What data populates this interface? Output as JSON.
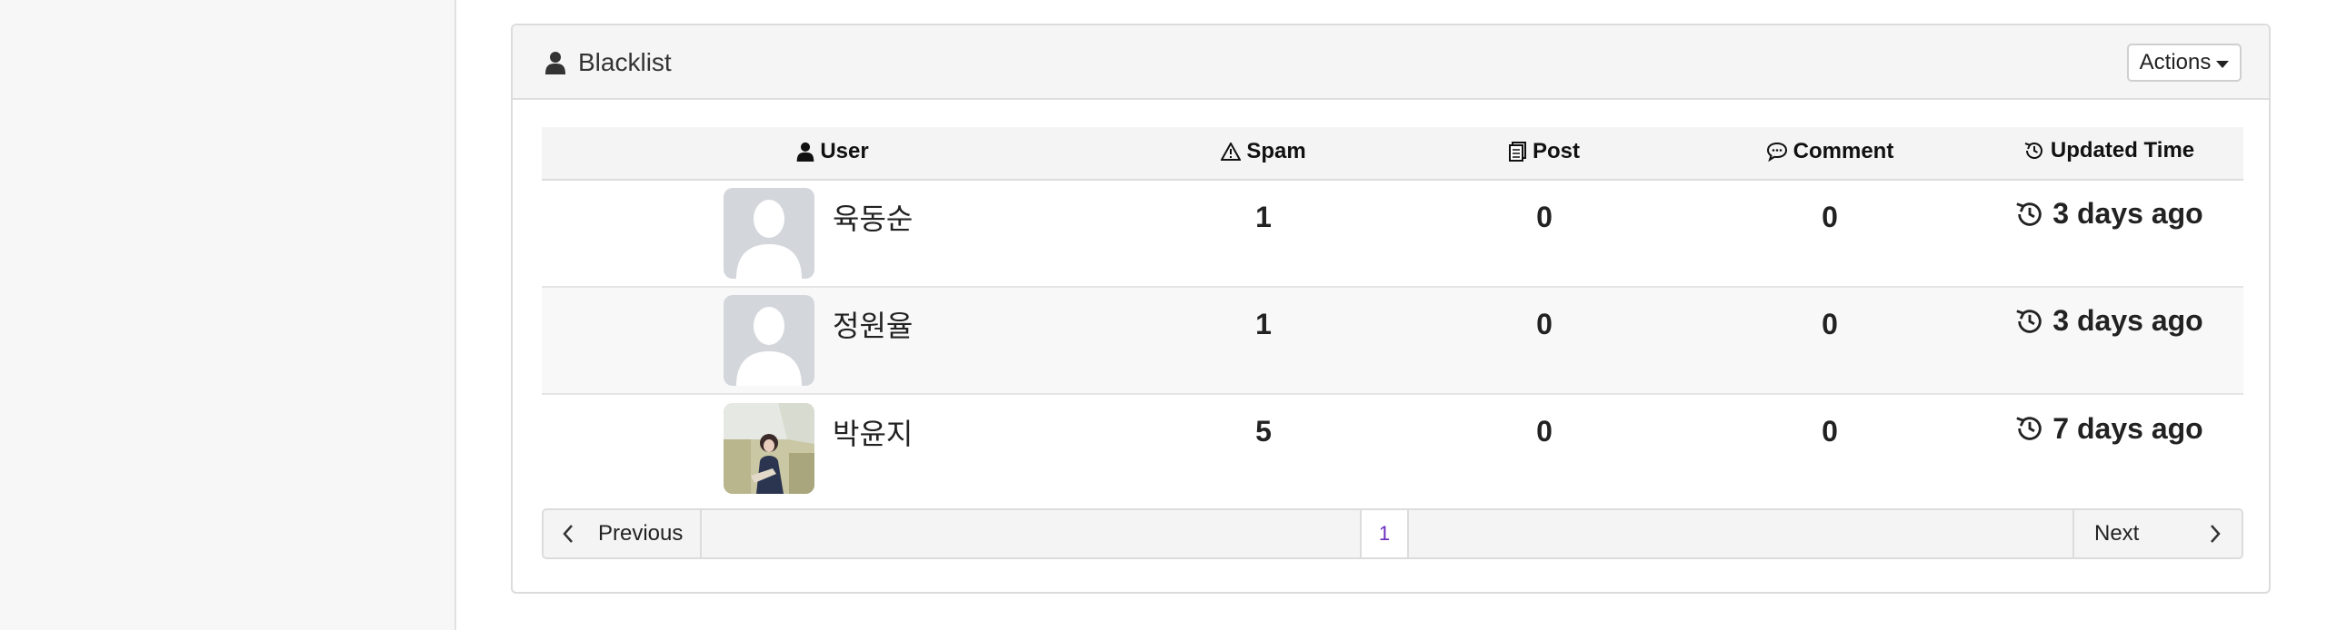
{
  "panel": {
    "title": "Blacklist",
    "actions_label": "Actions"
  },
  "table": {
    "headers": {
      "user": "User",
      "spam": "Spam",
      "post": "Post",
      "comment": "Comment",
      "updated": "Updated Time"
    },
    "rows": [
      {
        "name": "육동순",
        "spam": "1",
        "post": "0",
        "comment": "0",
        "updated": "3 days ago",
        "avatar": "default-avatar"
      },
      {
        "name": "정원율",
        "spam": "1",
        "post": "0",
        "comment": "0",
        "updated": "3 days ago",
        "avatar": "default-avatar"
      },
      {
        "name": "박윤지",
        "spam": "5",
        "post": "0",
        "comment": "0",
        "updated": "7 days ago",
        "avatar": "photo-avatar"
      }
    ]
  },
  "pagination": {
    "previous_label": "Previous",
    "next_label": "Next",
    "current_page": "1"
  },
  "colors": {
    "panel_header_bg": "#f5f5f5",
    "page_link": "#6a2bbf",
    "avatar_placeholder": "#d3d6db"
  }
}
